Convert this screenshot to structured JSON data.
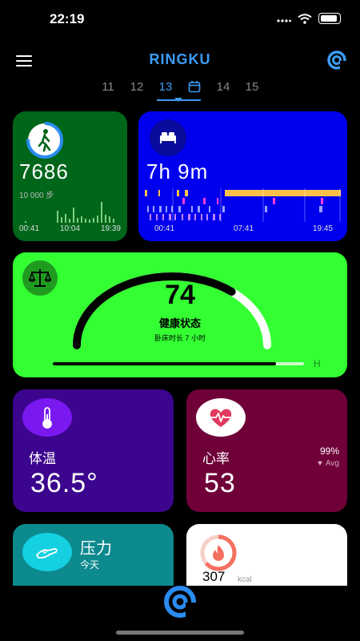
{
  "status_bar": {
    "time": "22:19"
  },
  "header": {
    "title": "RINGKU"
  },
  "date_strip": {
    "dates": [
      "11",
      "12",
      "13",
      "14",
      "15"
    ],
    "selected": "13"
  },
  "steps": {
    "value": "7686",
    "goal": "10 000 步",
    "times": [
      "00:41",
      "10:04",
      "19:39"
    ]
  },
  "sleep": {
    "duration": "7h 9m",
    "times": [
      "00:41",
      "07:41",
      "19:45"
    ]
  },
  "health": {
    "score": "74",
    "label": "健康状态",
    "sub": "卧床时长 7 小时",
    "scale_end": "H",
    "score_fraction": 0.74
  },
  "temperature": {
    "label": "体温",
    "value": "36.5°"
  },
  "heart_rate": {
    "label": "心率",
    "value": "53",
    "percent": "99%",
    "avg_label": "Avg"
  },
  "stress": {
    "label": "压力",
    "sub": "今天"
  },
  "calories": {
    "value": "307",
    "unit": "kcal"
  },
  "colors": {
    "accent": "#3b9cf5",
    "steps_bg": "#00661a",
    "sleep_bg": "#0000ee",
    "health_bg": "#33ff33",
    "temp_bg": "#3c058e",
    "heart_bg": "#6f0038",
    "stress_bg": "#0c8a8e"
  }
}
